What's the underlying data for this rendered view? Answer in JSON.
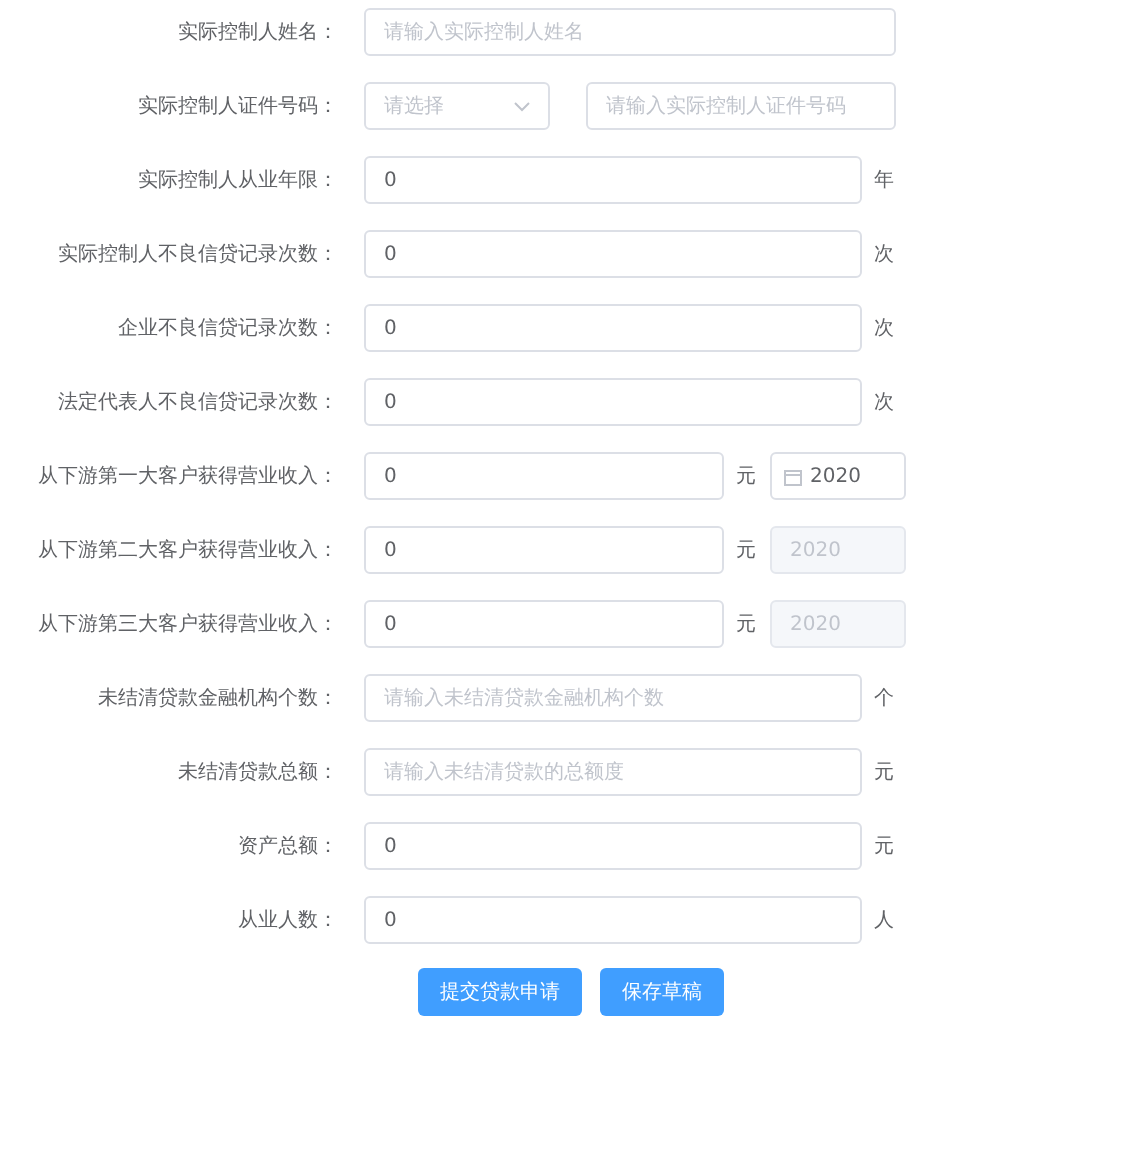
{
  "form": {
    "rows": [
      {
        "kind": "plain",
        "label": "实际控制人姓名：",
        "input": {
          "placeholder": "请输入实际控制人姓名"
        }
      },
      {
        "kind": "pair",
        "label": "实际控制人证件号码：",
        "select": {
          "placeholder": "请选择"
        },
        "input": {
          "placeholder": "请输入实际控制人证件号码"
        }
      },
      {
        "kind": "unit",
        "label": "实际控制人从业年限：",
        "input": {
          "value": "0"
        },
        "unit": "年"
      },
      {
        "kind": "unit",
        "label": "实际控制人不良信贷记录次数：",
        "input": {
          "value": "0"
        },
        "unit": "次"
      },
      {
        "kind": "unit",
        "label": "企业不良信贷记录次数：",
        "input": {
          "value": "0"
        },
        "unit": "次"
      },
      {
        "kind": "unit",
        "label": "法定代表人不良信贷记录次数：",
        "input": {
          "value": "0"
        },
        "unit": "次"
      },
      {
        "kind": "unit_date",
        "label": "从下游第一大客户获得营业收入：",
        "input": {
          "value": "0"
        },
        "unit": "元",
        "date": {
          "value": "2020",
          "disabled": false
        }
      },
      {
        "kind": "unit_date",
        "label": "从下游第二大客户获得营业收入：",
        "input": {
          "value": "0"
        },
        "unit": "元",
        "date": {
          "value": "2020",
          "disabled": true
        }
      },
      {
        "kind": "unit_date",
        "label": "从下游第三大客户获得营业收入：",
        "input": {
          "value": "0"
        },
        "unit": "元",
        "date": {
          "value": "2020",
          "disabled": true
        }
      },
      {
        "kind": "unit",
        "label": "未结清贷款金融机构个数：",
        "input": {
          "placeholder": "请输入未结清贷款金融机构个数"
        },
        "unit": "个"
      },
      {
        "kind": "unit",
        "label": "未结清贷款总额：",
        "input": {
          "placeholder": "请输入未结清贷款的总额度"
        },
        "unit": "元"
      },
      {
        "kind": "unit",
        "label": "资产总额：",
        "input": {
          "value": "0"
        },
        "unit": "元"
      },
      {
        "kind": "unit",
        "label": "从业人数：",
        "input": {
          "value": "0"
        },
        "unit": "人"
      }
    ]
  },
  "buttons": [
    "提交贷款申请",
    "保存草稿"
  ]
}
